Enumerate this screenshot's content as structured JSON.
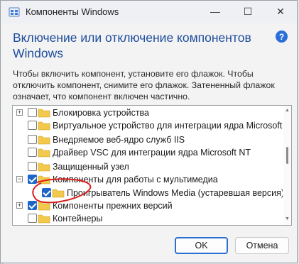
{
  "window": {
    "title": "Компоненты Windows",
    "minimize_glyph": "—",
    "maximize_glyph": "☐",
    "close_glyph": "✕"
  },
  "header": {
    "heading": "Включение или отключение компонентов Windows",
    "help_glyph": "?"
  },
  "description": "Чтобы включить компонент, установите его флажок. Чтобы отключить компонент, снимите его флажок. Затененный флажок означает, что компонент включен частично.",
  "tree": {
    "items": [
      {
        "label": "Блокировка устройства",
        "expander": "+",
        "checked": false,
        "indent": 0
      },
      {
        "label": "Виртуальное устройство для интеграции ядра Microsoft N",
        "expander": "",
        "checked": false,
        "indent": 0
      },
      {
        "label": "Внедряемое веб-ядро служб IIS",
        "expander": "",
        "checked": false,
        "indent": 0
      },
      {
        "label": "Драйвер VSC для интеграции ядра Microsoft NT",
        "expander": "",
        "checked": false,
        "indent": 0
      },
      {
        "label": "Защищенный узел",
        "expander": "",
        "checked": false,
        "indent": 0
      },
      {
        "label": "Компоненты для работы с мультимедиа",
        "expander": "−",
        "checked": true,
        "indent": 0
      },
      {
        "label": "Проигрыватель Windows Media (устаревшая версия) (",
        "expander": "",
        "checked": true,
        "indent": 1
      },
      {
        "label": "Компоненты прежних версий",
        "expander": "+",
        "checked": true,
        "indent": 0
      },
      {
        "label": "Контейнеры",
        "expander": "",
        "checked": false,
        "indent": 0
      }
    ]
  },
  "buttons": {
    "ok": "OK",
    "cancel": "Отмена"
  },
  "colors": {
    "accent": "#1d65c9",
    "heading": "#1e4d9b",
    "folder": "#f2c94c",
    "annotation": "#d9201b"
  }
}
